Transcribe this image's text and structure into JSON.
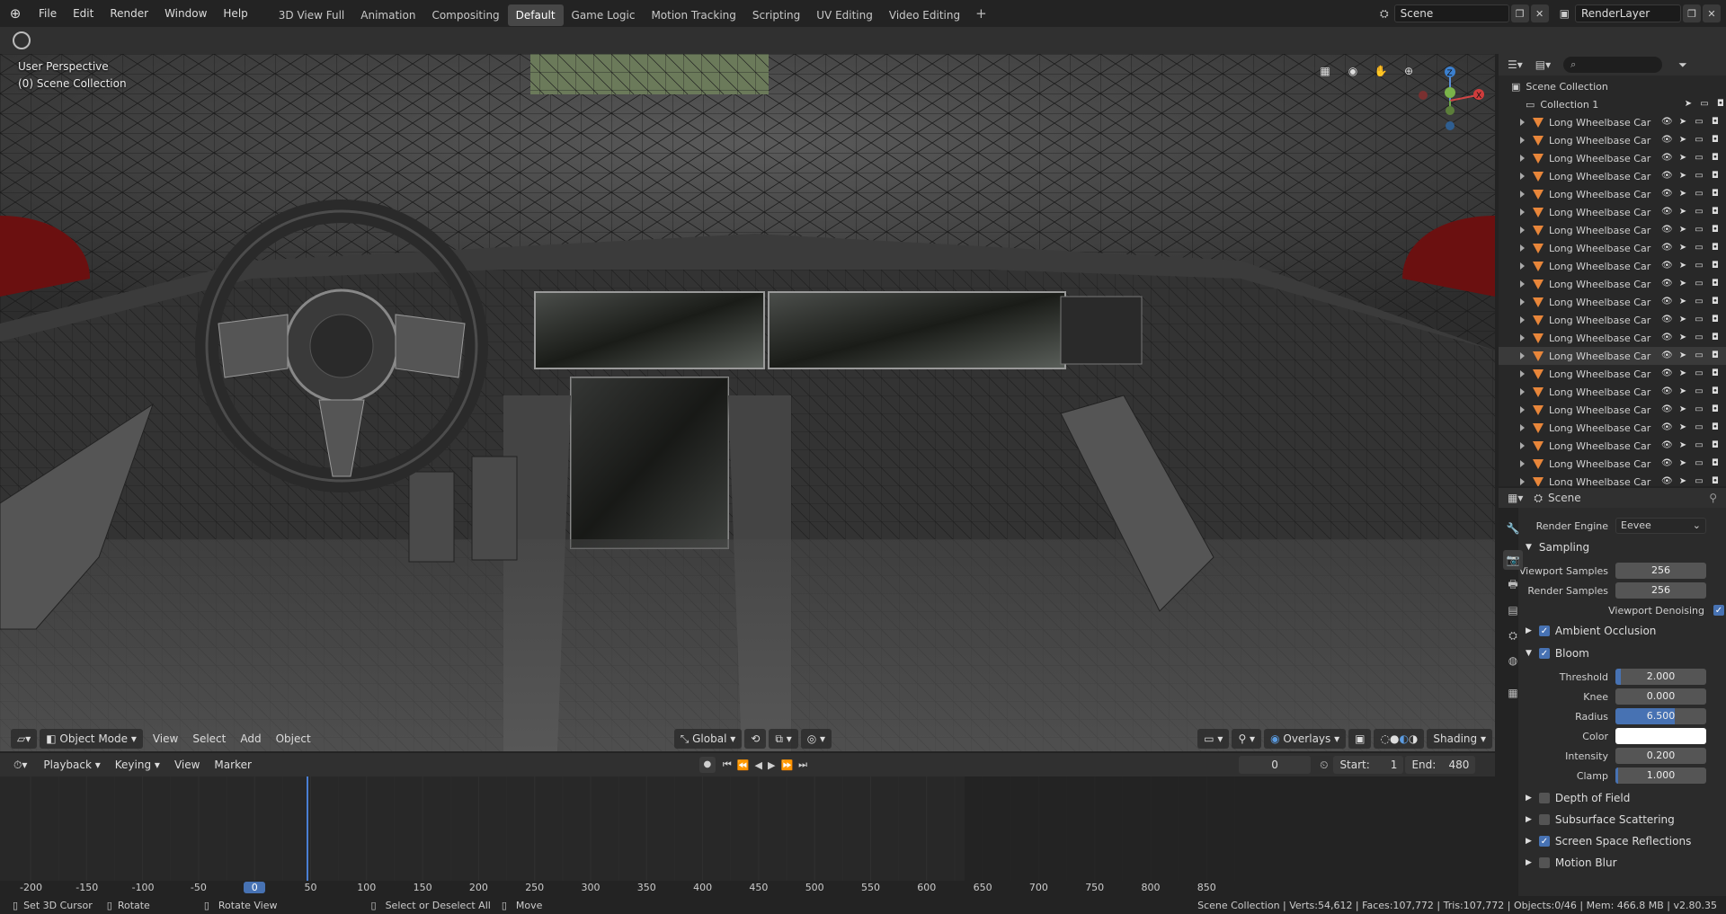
{
  "menu": [
    "File",
    "Edit",
    "Render",
    "Window",
    "Help"
  ],
  "workspaces": [
    "3D View Full",
    "Animation",
    "Compositing",
    "Default",
    "Game Logic",
    "Motion Tracking",
    "Scripting",
    "UV Editing",
    "Video Editing"
  ],
  "active_workspace": "Default",
  "scene_field": "Scene",
  "renderlayer_field": "RenderLayer",
  "viewport": {
    "perspective": "User Perspective",
    "collection": "(0) Scene Collection"
  },
  "vp_header": {
    "mode": "Object Mode",
    "view": "View",
    "select": "Select",
    "add": "Add",
    "object": "Object",
    "transform": "Global",
    "overlays": "Overlays",
    "shading": "Shading"
  },
  "timeline": {
    "playback": "Playback",
    "keying": "Keying",
    "view": "View",
    "marker": "Marker",
    "current": "0",
    "start_label": "Start:",
    "start": "1",
    "end_label": "End:",
    "end": "480"
  },
  "ruler_ticks": [
    "-200",
    "-150",
    "-100",
    "-50",
    "0",
    "50",
    "100",
    "150",
    "200",
    "250",
    "300",
    "350",
    "400",
    "450",
    "500",
    "550",
    "600",
    "650",
    "700",
    "750",
    "800",
    "850"
  ],
  "outliner": {
    "root": "Scene Collection",
    "collection": "Collection 1",
    "items": [
      "Long Wheelbase Car",
      "Long Wheelbase Car",
      "Long Wheelbase Car",
      "Long Wheelbase Car",
      "Long Wheelbase Car",
      "Long Wheelbase Car",
      "Long Wheelbase Car",
      "Long Wheelbase Car",
      "Long Wheelbase Car",
      "Long Wheelbase Car",
      "Long Wheelbase Car",
      "Long Wheelbase Car",
      "Long Wheelbase Car",
      "Long Wheelbase Car",
      "Long Wheelbase Car",
      "Long Wheelbase Car",
      "Long Wheelbase Car",
      "Long Wheelbase Car",
      "Long Wheelbase Car",
      "Long Wheelbase Car",
      "Long Wheelbase Car"
    ]
  },
  "props": {
    "context": "Scene",
    "render_engine_label": "Render Engine",
    "render_engine": "Eevee",
    "sampling": "Sampling",
    "viewport_samples_label": "Viewport Samples",
    "viewport_samples": "256",
    "render_samples_label": "Render Samples",
    "render_samples": "256",
    "viewport_denoising": "Viewport Denoising",
    "ambient_occlusion": "Ambient Occlusion",
    "bloom": "Bloom",
    "threshold_label": "Threshold",
    "threshold": "2.000",
    "knee_label": "Knee",
    "knee": "0.000",
    "radius_label": "Radius",
    "radius": "6.500",
    "color_label": "Color",
    "intensity_label": "Intensity",
    "intensity": "0.200",
    "clamp_label": "Clamp",
    "clamp": "1.000",
    "depth_of_field": "Depth of Field",
    "subsurface": "Subsurface Scattering",
    "ssr": "Screen Space Reflections",
    "motion_blur": "Motion Blur"
  },
  "status": {
    "set_cursor": "Set 3D Cursor",
    "rotate": "Rotate",
    "rotate_view": "Rotate View",
    "select": "Select or Deselect All",
    "move": "Move",
    "info": "Scene Collection | Verts:54,612 | Faces:107,772 | Tris:107,772 | Objects:0/46 | Mem: 466.8 MB | v2.80.35"
  },
  "colors": {
    "accent": "#4772b3",
    "mesh": "#e8863a",
    "active_tab": "#474747"
  }
}
